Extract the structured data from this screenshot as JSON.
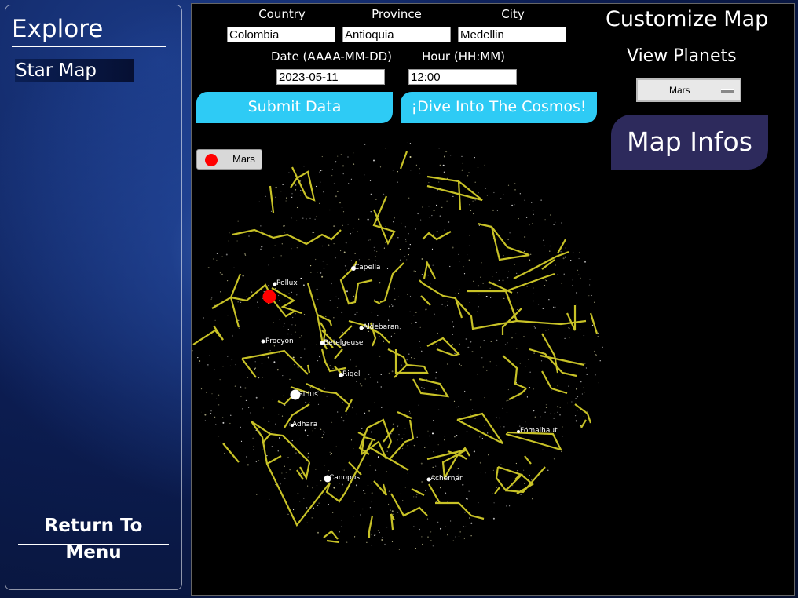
{
  "sidebar": {
    "title": "Explore",
    "nav_item": "Star Map",
    "return_label": "Return To Menu"
  },
  "form": {
    "country_label": "Country",
    "country_value": "Colombia",
    "province_label": "Province",
    "province_value": "Antioquia",
    "city_label": "City",
    "city_value": "Medellin",
    "date_label": "Date (AAAA-MM-DD)",
    "date_value": "2023-05-11",
    "hour_label": "Hour (HH:MM)",
    "hour_value": "12:00",
    "submit_label": "Submit Data",
    "dive_label": "¡Dive Into The Cosmos!"
  },
  "customize": {
    "title": "Customize Map",
    "view_planets_label": "View Planets",
    "selected_planet": "Mars",
    "map_infos_label": "Map Infos"
  },
  "map": {
    "legend_label": "Mars",
    "planet_color": "#ff0000",
    "line_color": "#c8c227",
    "stars": [
      "Capella",
      "Pollux",
      "Aldebaran",
      "Procyon",
      "Betelgeuse",
      "Rigel",
      "Sirius",
      "Adhara",
      "Fomalhaut",
      "Canopus",
      "Achernar"
    ]
  }
}
